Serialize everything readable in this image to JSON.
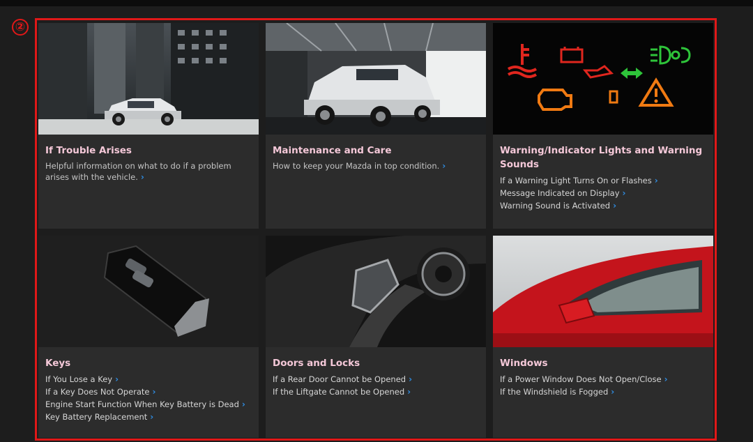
{
  "badge": "②",
  "cards": [
    {
      "title": "If Trouble Arises",
      "desc": "Helpful information on what to do if a problem arises with the vehicle.",
      "links": []
    },
    {
      "title": "Maintenance and Care",
      "desc": "How to keep your Mazda in top condition.",
      "links": []
    },
    {
      "title": "Warning/Indicator Lights and Warning Sounds",
      "desc": "",
      "links": [
        "If a Warning Light Turns On or Flashes",
        "Message Indicated on Display",
        "Warning Sound is Activated"
      ]
    },
    {
      "title": "Keys",
      "desc": "",
      "links": [
        "If You Lose a Key",
        "If a Key Does Not Operate",
        "Engine Start Function When Key Battery is Dead",
        "Key Battery Replacement"
      ]
    },
    {
      "title": "Doors and Locks",
      "desc": "",
      "links": [
        "If a Rear Door Cannot be Opened",
        "If the Liftgate Cannot be Opened"
      ]
    },
    {
      "title": "Windows",
      "desc": "",
      "links": [
        "If a Power Window Does Not Open/Close",
        "If the Windshield is Fogged"
      ]
    }
  ],
  "colors": {
    "highlight": "#e01818",
    "title": "#f4c8d8",
    "chevron": "#2f8ee5",
    "card_bg": "#2c2c2c"
  }
}
